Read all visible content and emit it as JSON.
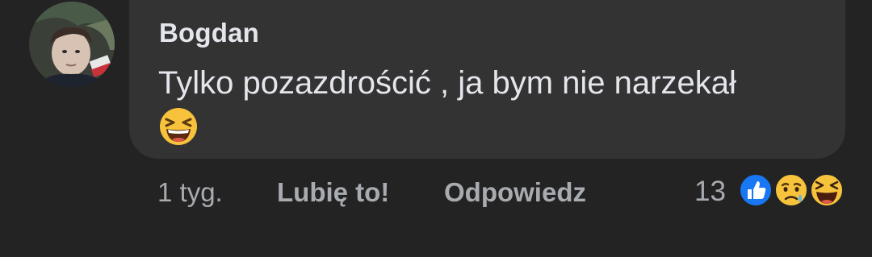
{
  "comment": {
    "author": "Bogdan",
    "text": "Tylko pozazdrościć , ja bym nie narzekał",
    "emoji_icon": "laughing-emoji-icon",
    "avatar_icon": "user-avatar"
  },
  "actions": {
    "time": "1 tyg.",
    "like_label": "Lubię to!",
    "reply_label": "Odpowiedz",
    "reaction_count": "13",
    "reactions": [
      "like-reaction-icon",
      "sad-reaction-icon",
      "haha-reaction-icon"
    ]
  },
  "colors": {
    "background": "#232324",
    "bubble": "#333334",
    "text": "#e4e6eb",
    "muted": "#a8abaf",
    "like_blue": "#1877f2",
    "emoji_yellow": "#f7c33c"
  }
}
